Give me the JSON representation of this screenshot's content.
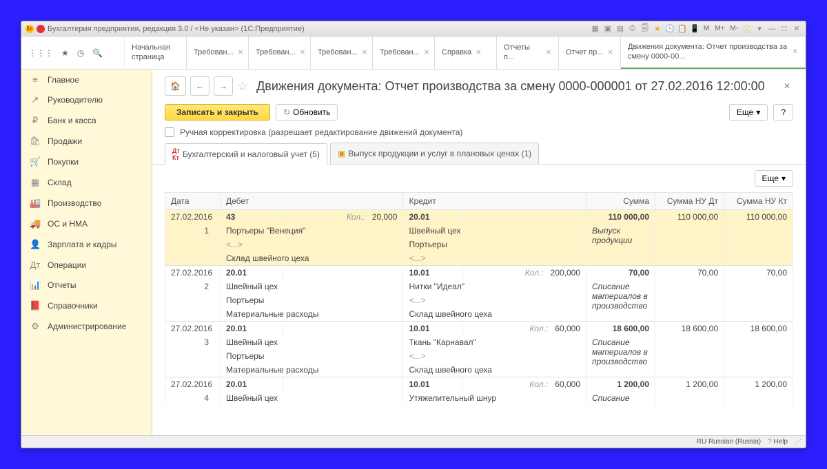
{
  "titlebar": {
    "app": "Бухгалтерия предприятия, редакция 3.0 / <Не указан>  (1С:Предприятие)",
    "m1": "M",
    "m2": "M+",
    "m3": "M-"
  },
  "topTabs": [
    {
      "label": "Начальная\nстраница"
    },
    {
      "label": "Требован..."
    },
    {
      "label": "Требован..."
    },
    {
      "label": "Требован..."
    },
    {
      "label": "Требован..."
    },
    {
      "label": "Справка"
    },
    {
      "label": "Отчеты п..."
    },
    {
      "label": "Отчет пр..."
    },
    {
      "label": "Движения документа: Отчет производства за смену 0000-00...",
      "active": true
    }
  ],
  "sidebar": [
    {
      "icon": "≡",
      "label": "Главное"
    },
    {
      "icon": "↗",
      "label": "Руководителю"
    },
    {
      "icon": "₽",
      "label": "Банк и касса"
    },
    {
      "icon": "🛍",
      "label": "Продажи"
    },
    {
      "icon": "🛒",
      "label": "Покупки"
    },
    {
      "icon": "▦",
      "label": "Склад"
    },
    {
      "icon": "🏭",
      "label": "Производство"
    },
    {
      "icon": "🚚",
      "label": "ОС и НМА"
    },
    {
      "icon": "👤",
      "label": "Зарплата и кадры"
    },
    {
      "icon": "Дт",
      "label": "Операции"
    },
    {
      "icon": "📊",
      "label": "Отчеты"
    },
    {
      "icon": "📕",
      "label": "Справочники"
    },
    {
      "icon": "⚙",
      "label": "Администрирование"
    }
  ],
  "page": {
    "title": "Движения документа: Отчет производства за смену 0000-000001 от 27.02.2016 12:00:00",
    "saveClose": "Записать и закрыть",
    "refresh": "Обновить",
    "more": "Еще",
    "help": "?",
    "manualEdit": "Ручная корректировка (разрешает редактирование движений документа)",
    "tab1": "Бухгалтерский и налоговый учет (5)",
    "tab2": "Выпуск продукции и услуг в плановых ценах (1)"
  },
  "cols": {
    "date": "Дата",
    "debit": "Дебет",
    "credit": "Кредит",
    "sum": "Сумма",
    "sumDt": "Сумма НУ Дт",
    "sumKt": "Сумма НУ Кт"
  },
  "labels": {
    "kol": "Кол.:",
    "ang": "<...>"
  },
  "rows": [
    {
      "date": "27.02.2016",
      "n": "1",
      "hl": true,
      "dAcc": "43",
      "dQty": "20,000",
      "cAcc": "20.01",
      "sum": "110 000,00",
      "sumDt": "110 000,00",
      "sumKt": "110 000,00",
      "d1": "Портьеры \"Венеция\"",
      "c1": "Швейный цех",
      "note": "Выпуск продукции",
      "d2": "<...>",
      "c2": "Портьеры",
      "d3": "Склад швейного цеха",
      "c3": "<...>"
    },
    {
      "date": "27.02.2016",
      "n": "2",
      "dAcc": "20.01",
      "cAcc": "10.01",
      "cQty": "200,000",
      "sum": "70,00",
      "sumDt": "70,00",
      "sumKt": "70,00",
      "d1": "Швейный цех",
      "c1": "Нитки \"Идеал\"",
      "note": "Списание материалов в производство",
      "d2": "Портьеры",
      "c2": "<...>",
      "d3": "Материальные расходы",
      "c3": "Склад швейного цеха"
    },
    {
      "date": "27.02.2016",
      "n": "3",
      "dAcc": "20.01",
      "cAcc": "10.01",
      "cQty": "60,000",
      "sum": "18 600,00",
      "sumDt": "18 600,00",
      "sumKt": "18 600,00",
      "d1": "Швейный цех",
      "c1": "Ткань \"Карнавал\"",
      "note": "Списание материалов в производство",
      "d2": "Портьеры",
      "c2": "<...>",
      "d3": "Материальные расходы",
      "c3": "Склад швейного цеха"
    },
    {
      "date": "27.02.2016",
      "n": "4",
      "dAcc": "20.01",
      "cAcc": "10.01",
      "cQty": "60,000",
      "sum": "1 200,00",
      "sumDt": "1 200,00",
      "sumKt": "1 200,00",
      "d1": "Швейный цех",
      "c1": "Утяжелительный шнур",
      "note": "Списание"
    }
  ],
  "status": {
    "lang": "RU Russian (Russia)",
    "help": "Help"
  }
}
